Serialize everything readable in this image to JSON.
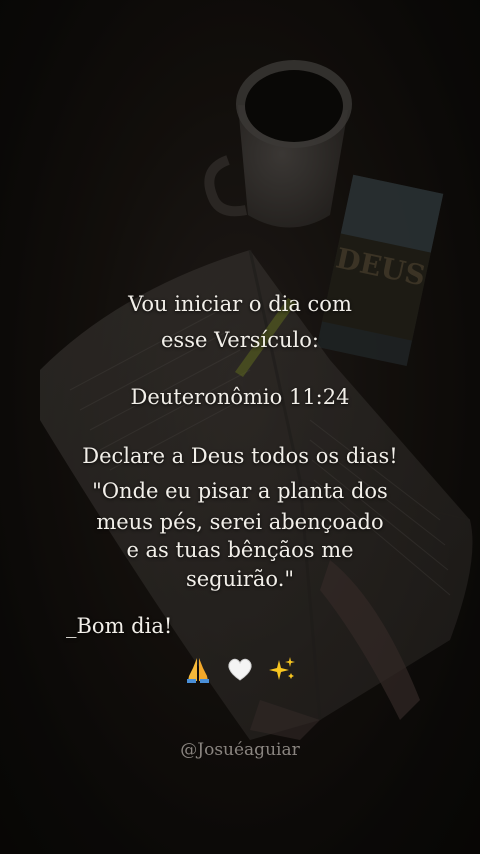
{
  "caption": {
    "intro_line1": "Vou iniciar o dia com",
    "intro_line2": "esse Versículo:",
    "reference": "Deuteronômio 11:24",
    "verse_line1": "Declare a Deus todos os dias!",
    "verse_line2": "\"Onde eu pisar a planta dos",
    "verse_line3": "meus pés, serei abençoado",
    "verse_line4": "e as tuas bênçãos me",
    "verse_line5": "seguirão.\"",
    "greeting": "_Bom dia!",
    "emojis": [
      "praying-hands",
      "white-heart",
      "sparkles"
    ]
  },
  "credit": "@Josuéaguiar",
  "background": {
    "book_cover_text": "DEUS"
  },
  "colors": {
    "text": "#f2efe9",
    "credit": "#8a8580",
    "background": "#0d0a09"
  }
}
